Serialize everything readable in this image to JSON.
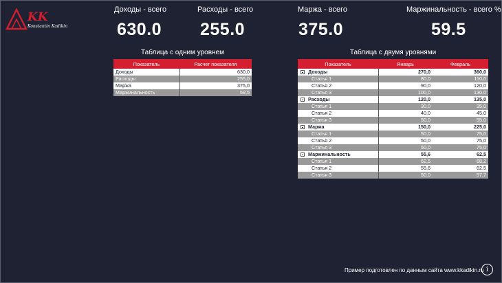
{
  "logo": {
    "letters": "KK",
    "caption": "Konstantin Kadikin",
    "accent": "#d31f2f"
  },
  "kpis": [
    {
      "label": "Доходы - всего",
      "value": "630.0"
    },
    {
      "label": "Расходы - всего",
      "value": "255.0"
    },
    {
      "label": "Маржа - всего",
      "value": "375.0"
    },
    {
      "label": "Маржинальность - всего %",
      "value": "59.5"
    }
  ],
  "table1": {
    "title": "Таблица с одним уровнем",
    "headers": [
      "Показатель",
      "Расчет показателя"
    ],
    "rows": [
      {
        "name": "Доходы",
        "value": "630,0"
      },
      {
        "name": "Расходы",
        "value": "255,0"
      },
      {
        "name": "Маржа",
        "value": "375,0"
      },
      {
        "name": "Маржинальность",
        "value": "59,5"
      }
    ]
  },
  "table2": {
    "title": "Таблица с двумя уровнями",
    "headers": [
      "Показатель",
      "Январь",
      "Февраль"
    ],
    "groups": [
      {
        "name": "Доходы",
        "jan": "270,0",
        "feb": "360,0",
        "items": [
          {
            "name": "Статья 1",
            "jan": "80,0",
            "feb": "110,0"
          },
          {
            "name": "Статья 2",
            "jan": "90,0",
            "feb": "120,0"
          },
          {
            "name": "Статья 3",
            "jan": "100,0",
            "feb": "130,0"
          }
        ]
      },
      {
        "name": "Расходы",
        "jan": "120,0",
        "feb": "135,0",
        "items": [
          {
            "name": "Статья 1",
            "jan": "30,0",
            "feb": "35,0"
          },
          {
            "name": "Статья 2",
            "jan": "40,0",
            "feb": "45,0"
          },
          {
            "name": "Статья 3",
            "jan": "50,0",
            "feb": "55,0"
          }
        ]
      },
      {
        "name": "Маржа",
        "jan": "150,0",
        "feb": "225,0",
        "items": [
          {
            "name": "Статья 1",
            "jan": "50,0",
            "feb": "75,0"
          },
          {
            "name": "Статья 2",
            "jan": "50,0",
            "feb": "75,0"
          },
          {
            "name": "Статья 3",
            "jan": "50,0",
            "feb": "75,0"
          }
        ]
      },
      {
        "name": "Маржинальность",
        "jan": "55,6",
        "feb": "62,5",
        "items": [
          {
            "name": "Статья 1",
            "jan": "62,5",
            "feb": "68,2"
          },
          {
            "name": "Статья 2",
            "jan": "55,6",
            "feb": "62,5"
          },
          {
            "name": "Статья 3",
            "jan": "50,0",
            "feb": "57,7"
          }
        ]
      }
    ]
  },
  "footer": {
    "text": "Пример подготовлен по данным сайта www.kkadikin.ru",
    "info_icon": "info-icon",
    "info_glyph": "i"
  }
}
